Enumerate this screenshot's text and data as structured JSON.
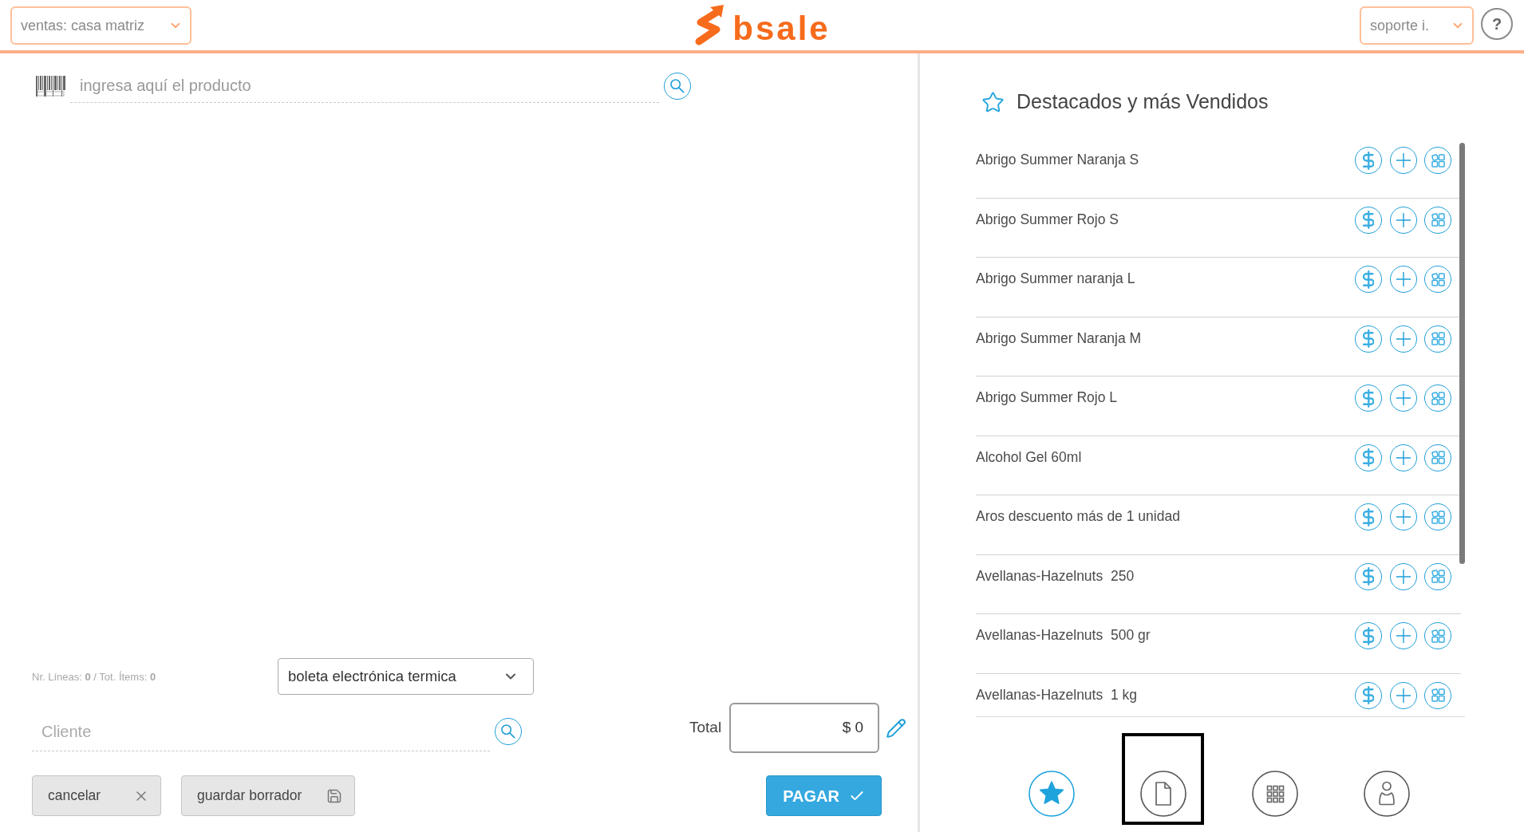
{
  "header": {
    "branch_select": {
      "value": "ventas: casa matriz"
    },
    "logo": {
      "text": "bsale"
    },
    "user_select": {
      "value": "soporte i."
    },
    "help_button": {
      "label": "?"
    }
  },
  "product_search": {
    "placeholder": "ingresa aquí el producto"
  },
  "sale_footer": {
    "summary": "Nr. Líneas: **0** / Tot. Ítems: **0**",
    "document_type": {
      "value": "boleta electrónica termica"
    },
    "client_search": {
      "placeholder": "Cliente"
    },
    "total": {
      "label": "Total",
      "value": "$ 0"
    },
    "actions": [
      {
        "kind": "cancel",
        "label": "cancelar"
      },
      {
        "kind": "draft",
        "label": "guardar borrador"
      },
      {
        "kind": "pay",
        "label": "PAGAR"
      }
    ]
  },
  "featured": {
    "title": "Destacados y más Vendidos",
    "items": [
      {
        "name": "Abrigo Summer Naranja S"
      },
      {
        "name": "Abrigo Summer Rojo S"
      },
      {
        "name": "Abrigo Summer naranja L"
      },
      {
        "name": "Abrigo Summer Naranja M"
      },
      {
        "name": "Abrigo Summer Rojo L"
      },
      {
        "name": "Alcohol Gel 60ml"
      },
      {
        "name": "Aros descuento más de 1 unidad"
      },
      {
        "name": "Avellanas-Hazelnuts  250"
      },
      {
        "name": "Avellanas-Hazelnuts  500 gr"
      },
      {
        "name": "Avellanas-Hazelnuts  1 kg"
      }
    ]
  },
  "bottom_nav": [
    {
      "kind": "favorites",
      "selected": true,
      "focused": false
    },
    {
      "kind": "document",
      "selected": false,
      "focused": true
    },
    {
      "kind": "grid",
      "selected": false,
      "focused": false
    },
    {
      "kind": "client",
      "selected": false,
      "focused": false
    }
  ]
}
